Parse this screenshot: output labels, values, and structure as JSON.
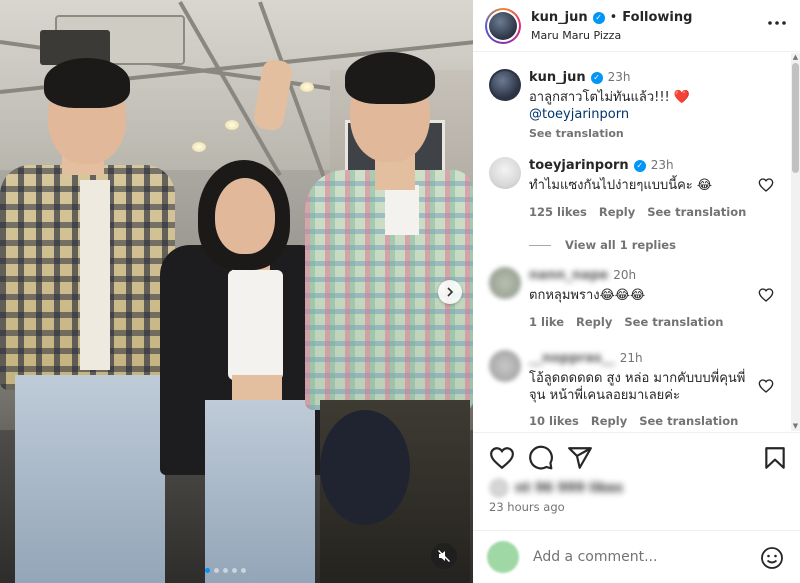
{
  "post": {
    "username": "kun_jun",
    "follow_status": "Following",
    "location": "Maru Maru Pizza",
    "caption_time": "23h",
    "caption_text": "อาลูกสาวโตไม่ทันแล้ว!!! ❤️",
    "caption_mention": "@toeyjarinporn",
    "see_translation": "See translation",
    "time_ago": "23 hours ago",
    "likes_text": "nt 96 999 likes"
  },
  "comments": [
    {
      "username": "toeyjarinporn",
      "verified": true,
      "time": "23h",
      "text": "ทำไมแซงกันไปง่ายๆแบบนี้คะ 😂",
      "likes": "125 likes",
      "reply": "Reply",
      "see_translation": "See translation"
    },
    {
      "username": "nann_nape",
      "time": "20h",
      "text": "ตกหลุมพราง😂😂😂",
      "likes": "1 like",
      "reply": "Reply",
      "see_translation": "See translation"
    },
    {
      "username": "__noppras__",
      "time": "21h",
      "text": "โอ้ลูดดดดดด สูง หล่อ มากคับบบพี่คุนพี่จุน หน้าพี่เคนลอยมาเลยค่ะ",
      "likes": "10 likes",
      "reply": "Reply",
      "see_translation": "See translation"
    }
  ],
  "view_replies": "View all 1 replies",
  "add_comment_placeholder": "Add a comment...",
  "colors": {
    "verified": "#0095f6",
    "heart": "#e0245e",
    "link": "#00376b"
  },
  "icons": [
    "heart-icon",
    "comment-icon",
    "share-icon",
    "bookmark-icon",
    "more-icon",
    "emoji-icon",
    "mute-icon",
    "chevron-right-icon"
  ]
}
